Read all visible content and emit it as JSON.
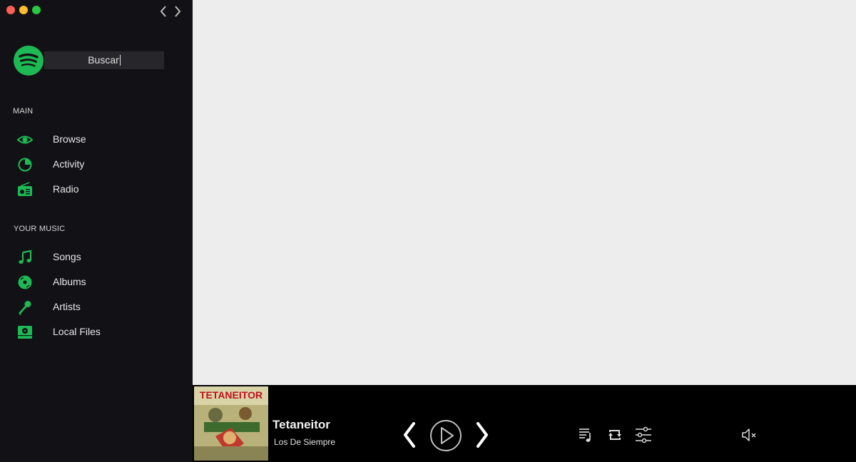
{
  "window": {
    "controls": [
      "close",
      "minimize",
      "maximize"
    ]
  },
  "search": {
    "value": "Buscar"
  },
  "sidebar": {
    "main_label": "MAIN",
    "main_items": [
      {
        "label": "Browse",
        "icon": "eye-icon"
      },
      {
        "label": "Activity",
        "icon": "pie-chart-icon"
      },
      {
        "label": "Radio",
        "icon": "radio-icon"
      }
    ],
    "music_label": "YOUR MUSIC",
    "music_items": [
      {
        "label": "Songs",
        "icon": "music-note-icon"
      },
      {
        "label": "Albums",
        "icon": "vinyl-disc-icon"
      },
      {
        "label": "Artists",
        "icon": "microphone-icon"
      },
      {
        "label": "Local Files",
        "icon": "hard-drive-icon"
      }
    ]
  },
  "player": {
    "title": "Tetaneitor",
    "artist": "Los De Siempre",
    "album_art_text": "TETANEITOR",
    "volume_muted": true
  },
  "colors": {
    "accent": "#1db954",
    "sidebar_bg": "#121216",
    "player_bg": "#000000",
    "main_bg": "#ededed"
  }
}
